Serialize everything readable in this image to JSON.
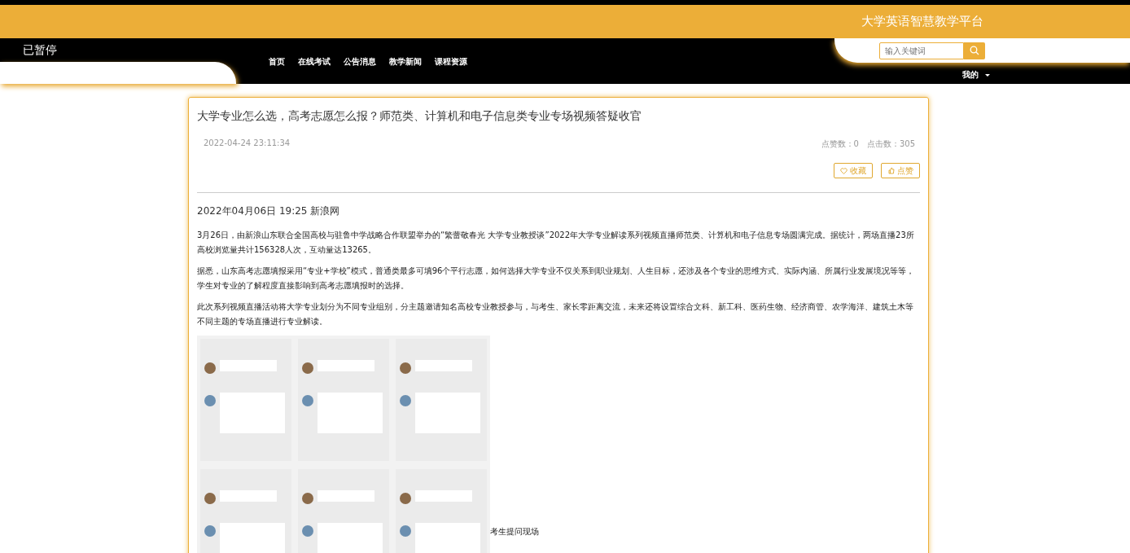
{
  "header": {
    "site_title": "大学英语智慧教学平台",
    "status": "已暂停",
    "search": {
      "placeholder": "输入关键词"
    },
    "nav": [
      {
        "label": "首页",
        "selected": false
      },
      {
        "label": "在线考试",
        "selected": false
      },
      {
        "label": "公告消息",
        "selected": false
      },
      {
        "label": "教学新闻",
        "selected": false
      },
      {
        "label": "课程资源",
        "selected": false
      }
    ],
    "user_menu": "我的"
  },
  "article": {
    "title": "大学专业怎么选，高考志愿怎么报？师范类、计算机和电子信息类专业专场视频答疑收官",
    "date": "2022-04-24 23:11:34",
    "likes": "点赞数：0",
    "clicks": "点击数：305",
    "buttons": [
      {
        "kind": "favorite",
        "label": "收藏"
      },
      {
        "kind": "like",
        "label": "点赞"
      }
    ],
    "source": "2022年04月06日 19:25 新浪网",
    "paragraphs": [
      "3月26日，由新浪山东联合全国高校与驻鲁中学战略合作联盟举办的“繁蕾敬春光 大学专业教授谈”2022年大学专业解读系列视频直播师范类、计算机和电子信息专场圆满完成。据统计，两场直播23所高校浏览量共计156328人次，互动量达13265。",
      "据悉，山东高考志愿填报采用“专业+学校”模式，普通类最多可填96个平行志愿，如何选择大学专业不仅关系到职业规划、人生目标，还涉及各个专业的思维方式、实际内涵、所属行业发展境况等等，学生对专业的了解程度直接影响到高考志愿填报时的选择。",
      "此次系列视频直播活动将大学专业划分为不同专业组别，分主题邀请知名高校专业教授参与，与考生、家长零距离交流，未来还将设置综合文科、新工科、医药生物、经济商管、农学海洋、建筑土木等不同主题的专场直播进行专业解读。"
    ],
    "figure": {
      "kind": "picture",
      "caption": "考生提问现场"
    }
  }
}
